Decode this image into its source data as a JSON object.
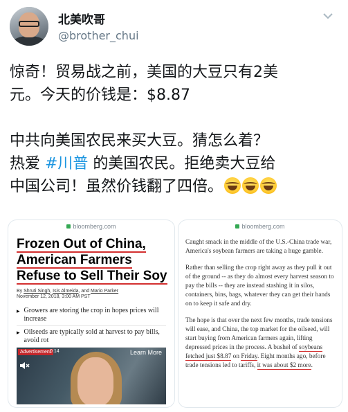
{
  "tweet": {
    "display_name": "北美吹哥",
    "handle": "@brother_chui",
    "line1": "惊奇！贸易战之前，美国的大豆只有2美",
    "line2": "元。今天的价钱是：$8.87",
    "line3": "中共向美国农民来买大豆。猜怎么着？",
    "line4_pre": "热爱 ",
    "hashtag": "#川普",
    "line4_post": " 的美国农民。拒绝卖大豆给",
    "line5": "中国公司！虽然价钱翻了四倍。"
  },
  "card_left": {
    "url": "bloomberg.com",
    "headline": [
      "Frozen Out of China,",
      "American Farmers",
      "Refuse to Sell Their Soy"
    ],
    "byline_prefix": "By ",
    "authors": [
      "Shruti Singh",
      "Isis Almeida",
      "Mario Parker"
    ],
    "byline_sep1": ", ",
    "byline_sep2": ", and ",
    "date": "November 12, 2018, 3:00 AM PST",
    "bullets": [
      "Growers are storing the crop in hopes prices will increase",
      "Oilseeds are typically sold at harvest to pay bills, avoid rot"
    ],
    "video": {
      "ad_label": "Advertisement",
      "time": "0:14",
      "learn_more": "Learn More"
    }
  },
  "card_right": {
    "url": "bloomberg.com",
    "p1": "Caught smack in the middle of the U.S.-China trade war, America's soybean farmers are taking a huge gamble.",
    "p2": "Rather than selling the crop right away as they pull it out of the ground -- as they do almost every harvest season to pay the bills -- they are instead stashing it in silos, containers, bins, bags, whatever they can get their hands on to keep it safe and dry.",
    "p3_a": "The hope is that over the next few months, trade tensions will ease, and China, the top market for the oilseed, will start buying from American farmers again, lifting depressed prices in the process. A bushel of ",
    "p3_ul1": "soybeans fetched just $8.87",
    "p3_b": " on ",
    "p3_ul2": "Friday",
    "p3_c": ". Eight months ago, before trade tensions led to tariffs, ",
    "p3_ul3": "it was about $2 more",
    "p3_d": "."
  }
}
